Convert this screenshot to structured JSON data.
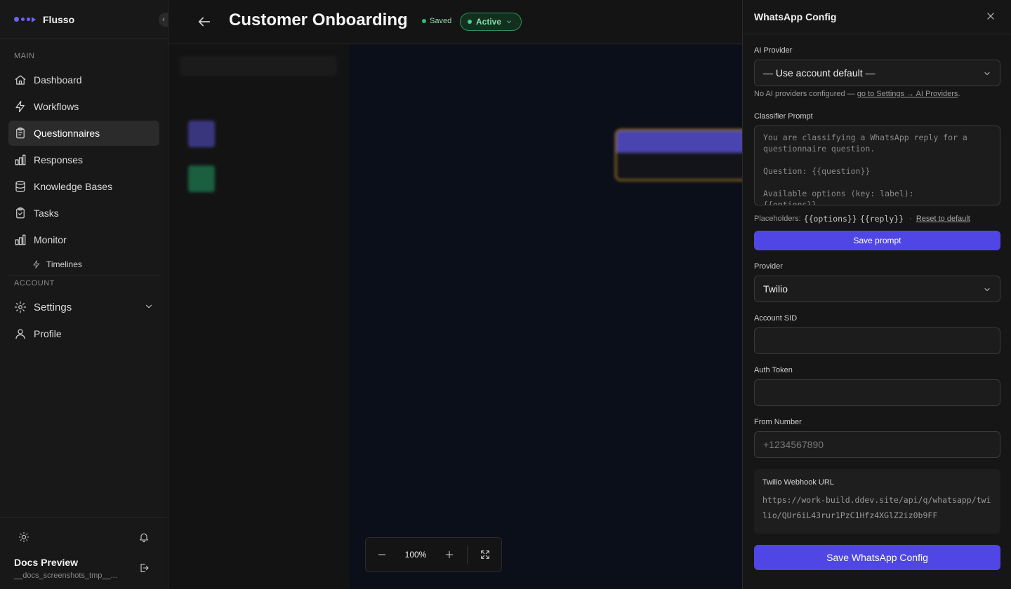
{
  "brand": {
    "name": "Flusso"
  },
  "sidebar": {
    "main_label": "MAIN",
    "account_label": "ACCOUNT",
    "items": [
      {
        "label": "Dashboard",
        "icon": "home-icon"
      },
      {
        "label": "Workflows",
        "icon": "bolt-icon"
      },
      {
        "label": "Questionnaires",
        "icon": "clipboard-icon",
        "active": true
      },
      {
        "label": "Responses",
        "icon": "bar-chart-icon"
      },
      {
        "label": "Knowledge Bases",
        "icon": "database-icon"
      },
      {
        "label": "Tasks",
        "icon": "clipboard-check-icon"
      },
      {
        "label": "Monitor",
        "icon": "bar-chart-icon"
      }
    ],
    "sub_items": [
      {
        "label": "Timelines",
        "icon": "bolt-icon"
      }
    ],
    "account_items": [
      {
        "label": "Settings",
        "icon": "gear-icon"
      },
      {
        "label": "Profile",
        "icon": "user-icon"
      }
    ],
    "user": {
      "name": "Docs Preview",
      "email": "__docs_screenshots_tmp__..."
    }
  },
  "header": {
    "title": "Customer Onboarding",
    "saved": "Saved",
    "status": "Active"
  },
  "zoom": {
    "level": "100%"
  },
  "panel": {
    "title": "WhatsApp Config",
    "ai_provider": {
      "label": "AI Provider",
      "value": "— Use account default —",
      "hint_prefix": "No AI providers configured — ",
      "hint_link": "go to Settings → AI Providers",
      "hint_suffix": "."
    },
    "classifier": {
      "label": "Classifier Prompt",
      "text": "You are classifying a WhatsApp reply for a questionnaire question.\n\nQuestion: {{question}}\n\nAvailable options (key: label):\n{{options}}",
      "placeholders_label": "Placeholders:",
      "placeholder_options": "{{options}}",
      "placeholder_reply": "{{reply}}",
      "separator": "·",
      "reset_label": "Reset to default",
      "save_label": "Save prompt"
    },
    "provider": {
      "label": "Provider",
      "value": "Twilio"
    },
    "account_sid": {
      "label": "Account SID",
      "value": ""
    },
    "auth_token": {
      "label": "Auth Token",
      "value": ""
    },
    "from_number": {
      "label": "From Number",
      "placeholder": "+1234567890"
    },
    "webhook": {
      "label": "Twilio Webhook URL",
      "url": "https://work-build.ddev.site/api/q/whatsapp/twilio/QUr6iL43rur1PzC1Hfz4XGlZ2iz0b9FF"
    },
    "save_label": "Save WhatsApp Config"
  },
  "colors": {
    "accent": "#5046e5",
    "status_green": "#3fd389",
    "node_border": "#e3a21a"
  }
}
